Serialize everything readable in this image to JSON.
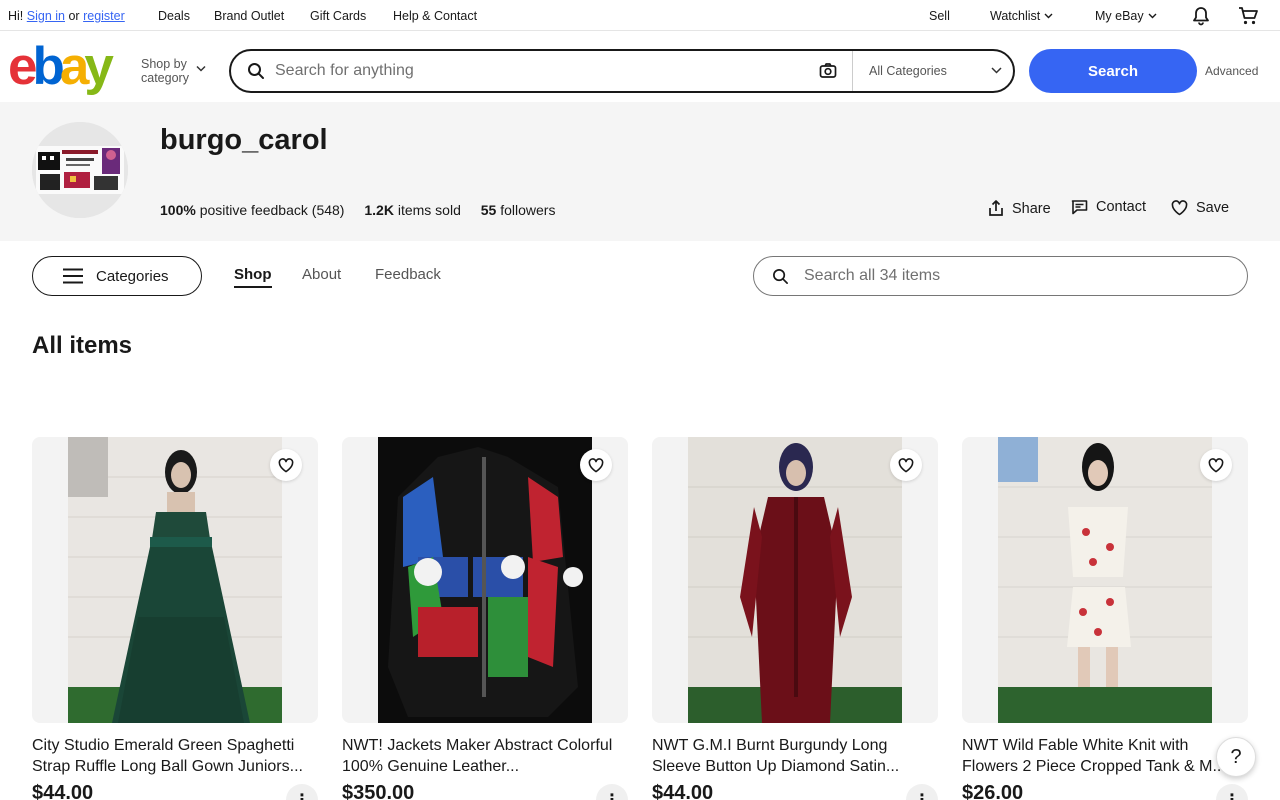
{
  "topnav": {
    "greeting_prefix": "Hi!",
    "sign_in": "Sign in",
    "or": "or",
    "register": "register",
    "deals": "Deals",
    "brand_outlet": "Brand Outlet",
    "gift_cards": "Gift Cards",
    "help_contact": "Help & Contact",
    "sell": "Sell",
    "watchlist": "Watchlist",
    "my_ebay": "My eBay"
  },
  "header": {
    "logo": {
      "e": "e",
      "b": "b",
      "a": "a",
      "y": "y"
    },
    "shop_by_line1": "Shop by",
    "shop_by_line2": "category",
    "search_placeholder": "Search for anything",
    "category_select": "All Categories",
    "search_button": "Search",
    "advanced": "Advanced"
  },
  "seller": {
    "name": "burgo_carol",
    "feedback_pct": "100%",
    "feedback_label": "positive feedback",
    "feedback_count": "(548)",
    "items_sold_value": "1.2K",
    "items_sold_label": "items sold",
    "followers_value": "55",
    "followers_label": "followers",
    "share": "Share",
    "contact": "Contact",
    "save": "Save"
  },
  "shop_nav": {
    "categories": "Categories",
    "tabs": [
      "Shop",
      "About",
      "Feedback"
    ],
    "search_placeholder": "Search all 34 items"
  },
  "section_title": "All items",
  "products": [
    {
      "title": "City Studio Emerald Green Spaghetti Strap Ruffle Long Ball Gown Juniors...",
      "price": "$44.00"
    },
    {
      "title": "NWT! Jackets Maker Abstract Colorful 100% Genuine Leather...",
      "price": "$350.00"
    },
    {
      "title": "NWT G.M.I Burnt Burgundy Long Sleeve Button Up Diamond Satin...",
      "price": "$44.00"
    },
    {
      "title": "NWT Wild Fable White Knit with Flowers 2 Piece Cropped Tank & M...",
      "price": "$26.00"
    }
  ],
  "help_label": "?",
  "more_label": "⋮",
  "colors": {
    "brand_blue": "#3665f3",
    "logo_red": "#e53238",
    "logo_blue": "#0064d2",
    "logo_yellow": "#f5af02",
    "logo_green": "#86b817"
  }
}
